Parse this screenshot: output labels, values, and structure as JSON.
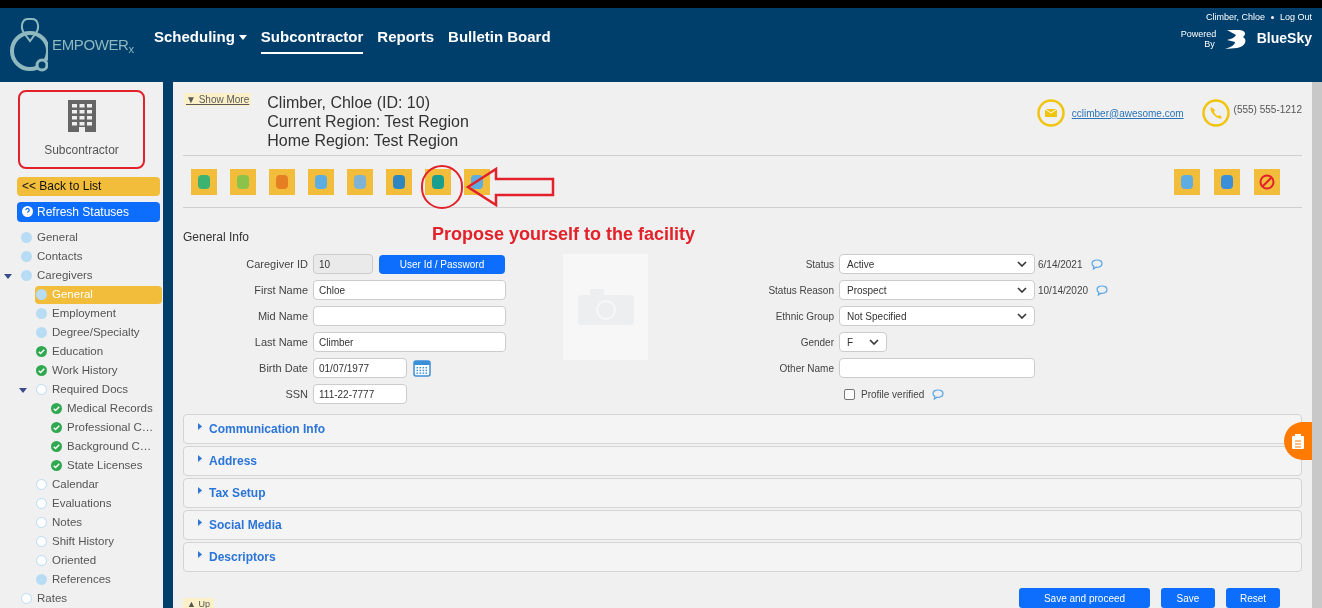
{
  "header": {
    "logo_text": "EMPOWER$_{x}$",
    "nav": [
      {
        "label": "Scheduling",
        "dropdown": true,
        "selected": false
      },
      {
        "label": "Subcontractor",
        "dropdown": false,
        "selected": true
      },
      {
        "label": "Reports",
        "dropdown": false,
        "selected": false
      },
      {
        "label": "Bulletin Board",
        "dropdown": false,
        "selected": false
      }
    ],
    "user": "Climber, Chloe",
    "logout": "Log Out",
    "powered_by": "Powered By",
    "brand": "BlueSky"
  },
  "sidebar": {
    "module": "Subcontractor",
    "back": "<< Back to List",
    "refresh": "Refresh Statuses",
    "items": [
      {
        "label": "General",
        "kind": "pending",
        "selected": false
      },
      {
        "label": "Contacts",
        "kind": "pending",
        "selected": false
      },
      {
        "label": "Caregivers",
        "kind": "pending",
        "selected": false,
        "expanded": true,
        "children": [
          {
            "label": "General",
            "kind": "pending",
            "selected": true
          },
          {
            "label": "Employment",
            "kind": "pending",
            "selected": false
          },
          {
            "label": "Degree/Specialty",
            "kind": "pending",
            "selected": false
          },
          {
            "label": "Education",
            "kind": "done",
            "selected": false
          },
          {
            "label": "Work History",
            "kind": "done",
            "selected": false
          },
          {
            "label": "Required Docs",
            "kind": "none",
            "selected": false,
            "expanded": true,
            "children": [
              {
                "label": "Medical Records",
                "kind": "done",
                "selected": false
              },
              {
                "label": "Professional C…",
                "kind": "done",
                "selected": false
              },
              {
                "label": "Background C…",
                "kind": "done",
                "selected": false
              },
              {
                "label": "State Licenses",
                "kind": "done",
                "selected": false
              }
            ]
          },
          {
            "label": "Calendar",
            "kind": "none",
            "selected": false
          },
          {
            "label": "Evaluations",
            "kind": "none",
            "selected": false
          },
          {
            "label": "Notes",
            "kind": "none",
            "selected": false
          },
          {
            "label": "Shift History",
            "kind": "none",
            "selected": false
          },
          {
            "label": "Oriented",
            "kind": "none",
            "selected": false
          },
          {
            "label": "References",
            "kind": "pending",
            "selected": false
          }
        ]
      },
      {
        "label": "Rates",
        "kind": "none",
        "selected": false
      }
    ]
  },
  "profile": {
    "show_more": "▼ Show More",
    "name": "Climber, Chloe (ID: 10)",
    "current_region": "Current Region: Test Region",
    "home_region": "Home Region: Test Region",
    "email": "cclimber@awesome.com",
    "phone": "(555) 555-1212"
  },
  "annotation": "Propose yourself to the facility",
  "form": {
    "title": "General Info",
    "left": [
      {
        "label": "Caregiver ID",
        "kind": "id",
        "value": "10",
        "button": "User Id / Password"
      },
      {
        "label": "First Name",
        "kind": "text",
        "value": "Chloe"
      },
      {
        "label": "Mid Name",
        "kind": "text"
      },
      {
        "label": "Last Name",
        "kind": "text",
        "value": "Climber"
      },
      {
        "label": "Birth Date",
        "kind": "date",
        "value": "01/07/1977"
      },
      {
        "label": "SSN",
        "kind": "short",
        "value": "111-22-7777"
      }
    ],
    "right": [
      {
        "label": "Status",
        "kind": "select",
        "value": "Active",
        "date": "6/14/2021"
      },
      {
        "label": "Status Reason",
        "kind": "select",
        "value": "Prospect",
        "date": "10/14/2020"
      },
      {
        "label": "Ethnic Group",
        "kind": "select",
        "value": "Not Specified"
      },
      {
        "label": "Gender",
        "kind": "small-select",
        "value": "F"
      },
      {
        "label": "Other Name",
        "kind": "text"
      },
      {
        "label": "Profile verified",
        "kind": "checkbox",
        "checked": false
      }
    ]
  },
  "sections": [
    {
      "title": "Communication Info",
      "expanded": false
    },
    {
      "title": "Address",
      "expanded": false
    },
    {
      "title": "Tax Setup",
      "expanded": false
    },
    {
      "title": "Social Media",
      "expanded": false
    },
    {
      "title": "Descriptors",
      "expanded": false
    }
  ],
  "footer": {
    "up": "▲ Up",
    "buttons": [
      "Save and proceed",
      "Save",
      "Reset"
    ]
  }
}
